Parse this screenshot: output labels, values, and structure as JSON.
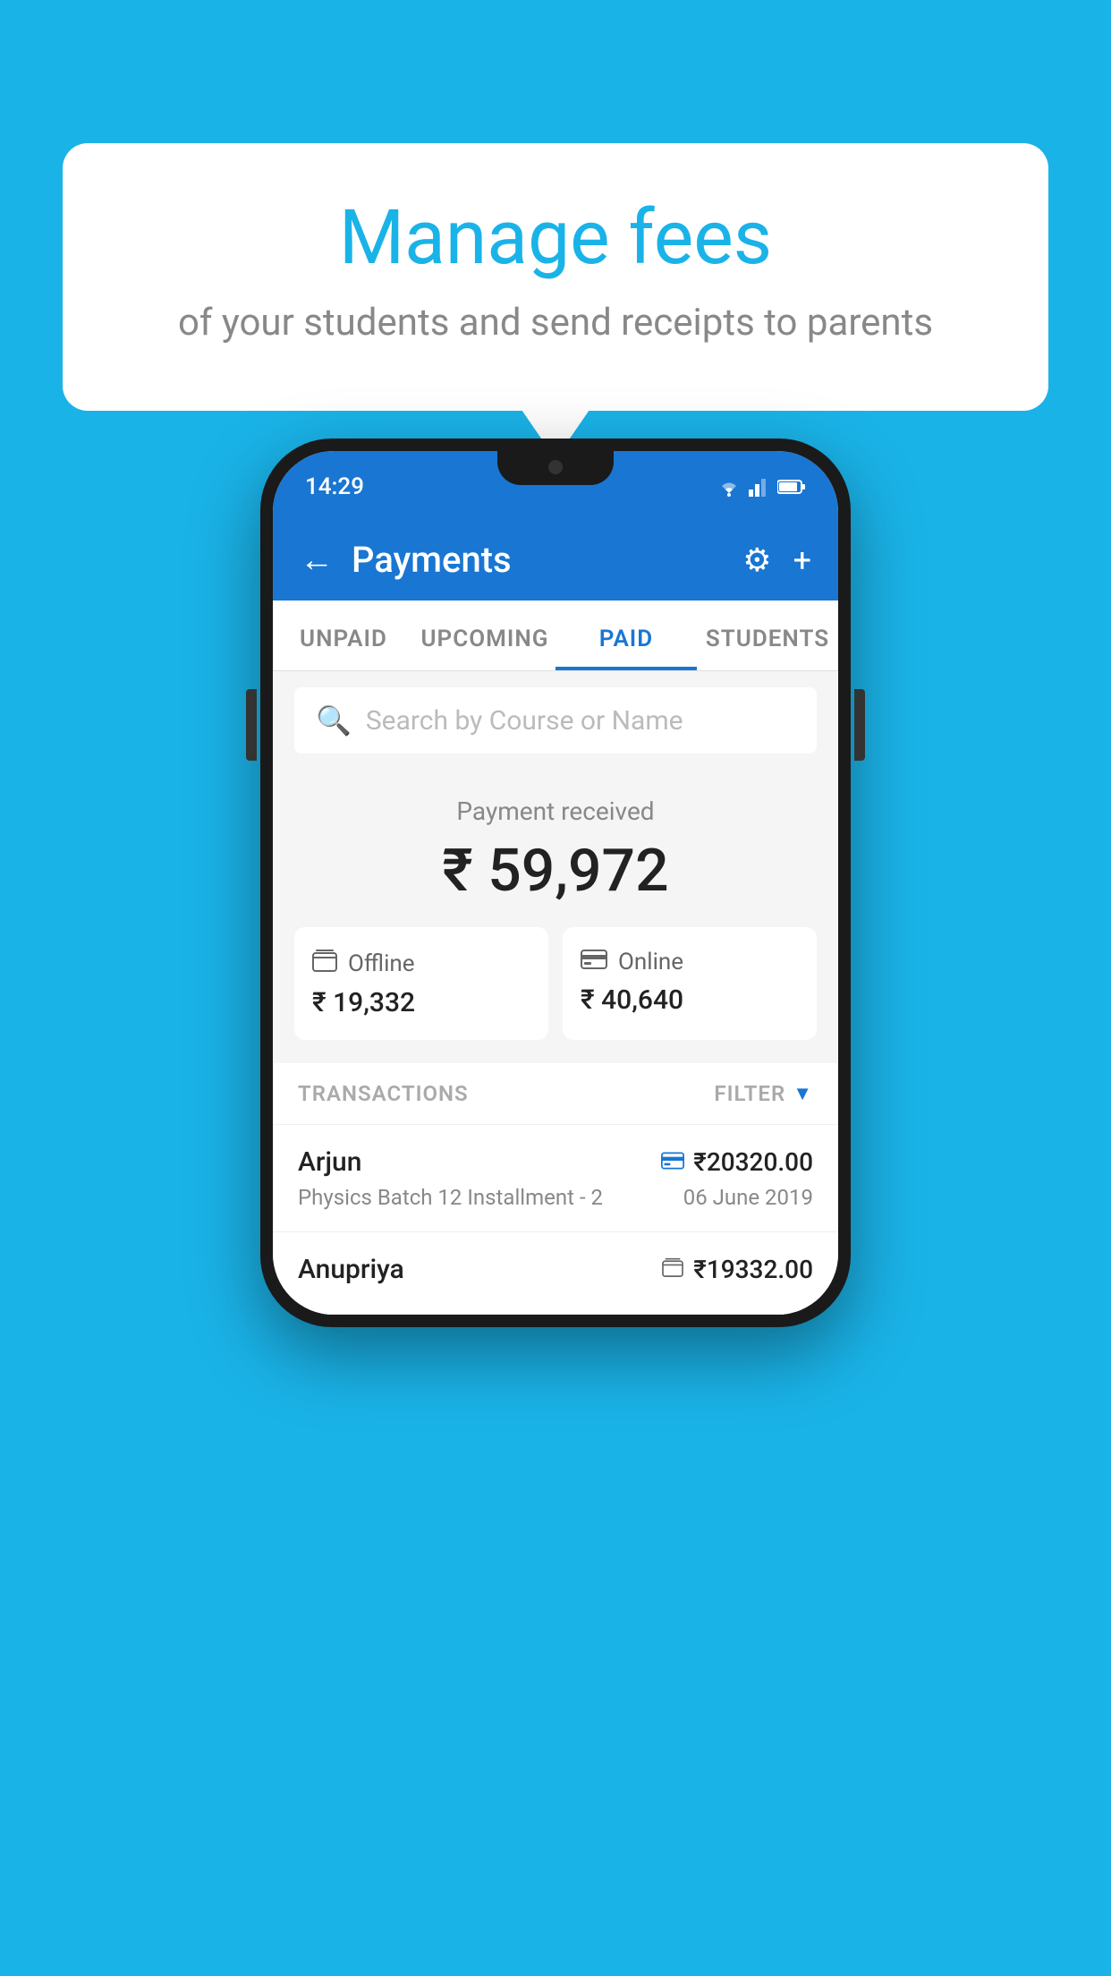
{
  "background_color": "#1ab3e8",
  "bubble": {
    "title": "Manage fees",
    "subtitle": "of your students and send receipts to parents"
  },
  "phone": {
    "status_bar": {
      "time": "14:29"
    },
    "header": {
      "title": "Payments",
      "back_label": "←",
      "settings_icon": "⚙",
      "add_icon": "+"
    },
    "tabs": [
      {
        "label": "UNPAID",
        "active": false
      },
      {
        "label": "UPCOMING",
        "active": false
      },
      {
        "label": "PAID",
        "active": true
      },
      {
        "label": "STUDENTS",
        "active": false
      }
    ],
    "search": {
      "placeholder": "Search by Course or Name"
    },
    "payment_summary": {
      "label": "Payment received",
      "amount": "₹ 59,972",
      "offline": {
        "icon": "💳",
        "label": "Offline",
        "amount": "₹ 19,332"
      },
      "online": {
        "icon": "💳",
        "label": "Online",
        "amount": "₹ 40,640"
      }
    },
    "transactions": {
      "header_label": "TRANSACTIONS",
      "filter_label": "FILTER",
      "items": [
        {
          "name": "Arjun",
          "amount": "₹20320.00",
          "course": "Physics Batch 12 Installment - 2",
          "date": "06 June 2019",
          "payment_type": "online"
        },
        {
          "name": "Anupriya",
          "amount": "₹19332.00",
          "course": "",
          "date": "",
          "payment_type": "offline"
        }
      ]
    }
  }
}
